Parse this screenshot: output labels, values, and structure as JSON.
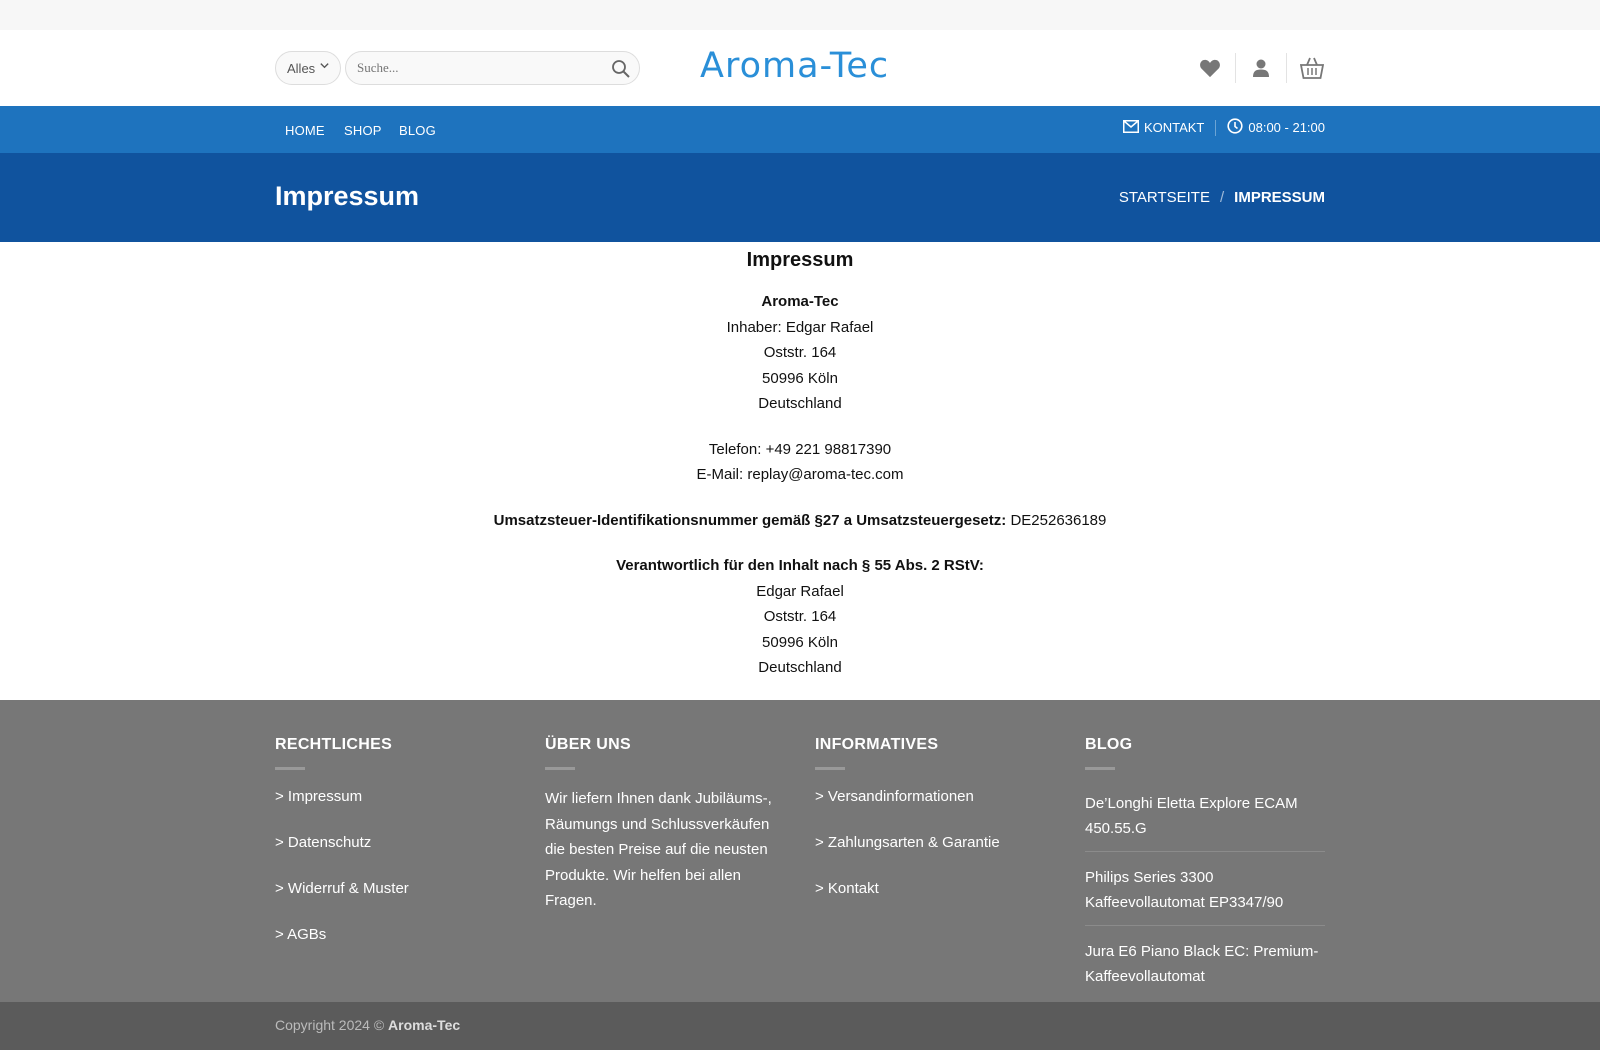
{
  "header": {
    "category_select": "Alles",
    "search_placeholder": "Suche...",
    "logo": "Aroma-Tec"
  },
  "nav": {
    "items": [
      "HOME",
      "SHOP",
      "BLOG"
    ],
    "contact": "KONTAKT",
    "hours": "08:00 - 21:00"
  },
  "title_bar": {
    "title": "Impressum",
    "breadcrumb_home": "STARTSEITE",
    "breadcrumb_sep": "/",
    "breadcrumb_current": "IMPRESSUM"
  },
  "content": {
    "heading": "Impressum",
    "company": "Aroma-Tec",
    "owner": "Inhaber: Edgar Rafael",
    "street": "Oststr. 164",
    "city": "50996 Köln",
    "country": "Deutschland",
    "phone": "Telefon: +49 221 98817390",
    "email": "E-Mail: replay@aroma-tec.com",
    "vat_label": "Umsatzsteuer-Identifikationsnummer gemäß §27 a Umsatzsteuergesetz:",
    "vat_value": "DE252636189",
    "resp_label": "Verantwortlich für den Inhalt nach § 55 Abs. 2 RStV:",
    "resp_name": "Edgar Rafael",
    "resp_street": "Oststr. 164",
    "resp_city": "50996 Köln",
    "resp_country": "Deutschland"
  },
  "footer": {
    "legal_title": "RECHTLICHES",
    "legal_links": [
      "> Impressum",
      "> Datenschutz",
      "> Widerruf & Muster",
      "> AGBs"
    ],
    "about_title": "ÜBER UNS",
    "about_text": "Wir liefern Ihnen dank Jubiläums-, Räumungs und Schlussverkäufen die besten Preise auf die neusten Produkte. Wir helfen bei allen Fragen.",
    "info_title": "INFORMATIVES",
    "info_links": [
      "> Versandinformationen",
      "> Zahlungsarten & Garantie",
      "> Kontakt"
    ],
    "blog_title": "BLOG",
    "blog_posts": [
      "De’Longhi Eletta Explore ECAM 450.55.G",
      "Philips Series 3300 Kaffeevollautomat EP3347/90",
      "Jura E6 Piano Black EC: Premium-Kaffeevollautomat"
    ]
  },
  "copyright": {
    "prefix": "Copyright 2024 ©",
    "brand": "Aroma-Tec"
  },
  "colors": {
    "nav_bg": "#1e73be",
    "title_bg": "#10539e",
    "footer_bg": "#777777",
    "copyright_bg": "#5b5b5b",
    "logo": "#2a8fd8"
  }
}
